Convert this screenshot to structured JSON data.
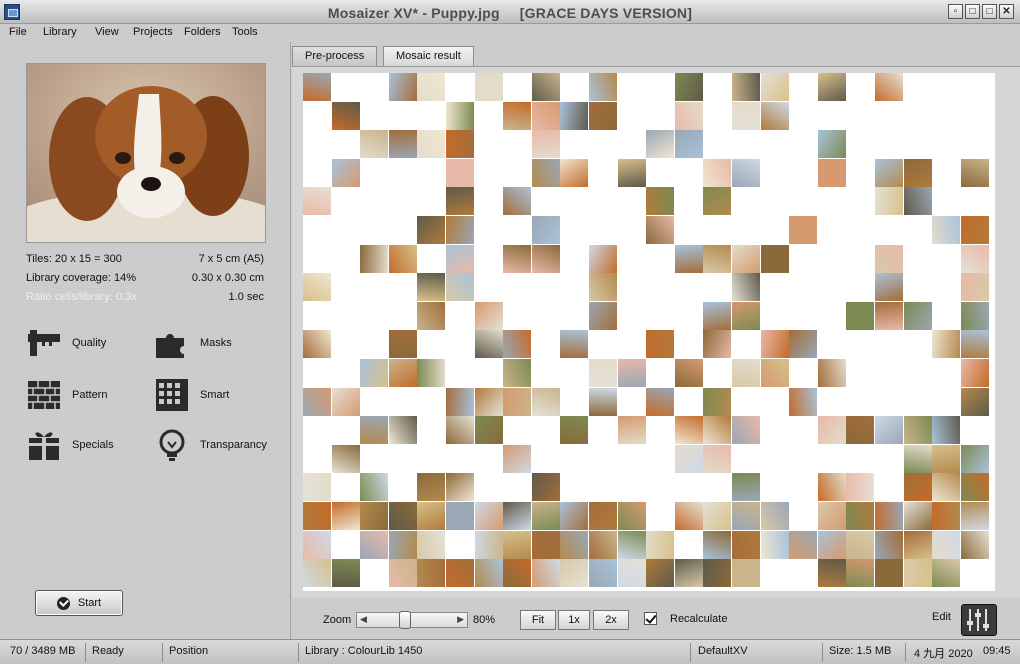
{
  "window": {
    "title": "Mosaizer XV* - Puppy.jpg",
    "edition": "[GRACE DAYS VERSION]",
    "minimize": "▫",
    "tile": "□",
    "restore": "□",
    "close": "✕"
  },
  "menu": [
    "File",
    "Library",
    "View",
    "Projects",
    "Folders",
    "Tools"
  ],
  "left": {
    "tiles": "Tiles: 20 x 15 = 300",
    "size_cm": "7 x 5 cm  (A5)",
    "coverage": "Library coverage: 14%",
    "cell_size": "0.30 x 0.30 cm",
    "ratio": "Ratio cells/library: 0.3x",
    "time": "1.0 sec",
    "tools": [
      {
        "label": "Quality",
        "icon": "quality-icon"
      },
      {
        "label": "Masks",
        "icon": "masks-puzzle-icon"
      },
      {
        "label": "Pattern",
        "icon": "pattern-bricks-icon"
      },
      {
        "label": "Smart",
        "icon": "smart-grid-icon"
      },
      {
        "label": "Specials",
        "icon": "specials-gift-icon"
      },
      {
        "label": "Transparancy",
        "icon": "transparancy-bulb-icon"
      }
    ],
    "start_label": "Start"
  },
  "tabs": [
    {
      "label": "Pre-process",
      "active": false
    },
    {
      "label": "Mosaic result",
      "active": true
    }
  ],
  "toolbar": {
    "zoom_label": "Zoom",
    "zoom_value": "80%",
    "zoom_fraction": 0.4,
    "fit_label": "Fit",
    "x1_label": "1x",
    "x2_label": "2x",
    "recalculate_label": "Recalculate",
    "recalculate_checked": true,
    "edit_label": "Edit"
  },
  "status": {
    "memory": "70 / 3489 MB",
    "state": "Ready",
    "position": "Position",
    "library": "Library : ColourLib 1450",
    "profile": "DefaultXV",
    "size": "Size: 1.5 MB",
    "date": "4 九月 2020",
    "time": "09:45"
  },
  "colors": {
    "tile_palette": [
      "#c9b48c",
      "#d8c9a8",
      "#e4dccb",
      "#b38a4e",
      "#8a6a3a",
      "#cfd9e6",
      "#a9c2da",
      "#e8b9a8",
      "#d69a6f",
      "#b07a3c",
      "#7c8a52",
      "#9aa7b4",
      "#e5e1d6",
      "#c46b2a",
      "#5e5a4a",
      "#d7c08a",
      "#f0e6d2",
      "#a36d3b"
    ]
  }
}
